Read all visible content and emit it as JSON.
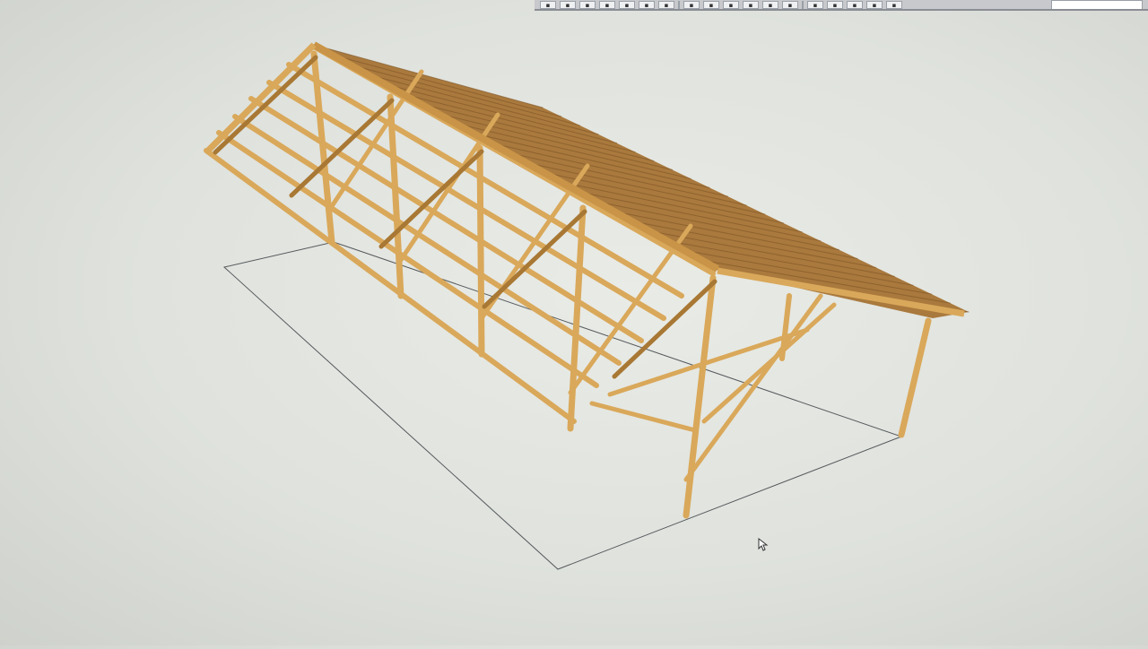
{
  "window": {
    "title": ""
  },
  "toolbar": {
    "buttons": [
      {
        "icon": "select-icon"
      },
      {
        "icon": "new-file-icon"
      },
      {
        "icon": "open-icon"
      },
      {
        "icon": "save-icon"
      },
      {
        "icon": "print-icon"
      },
      {
        "icon": "material-icon"
      },
      {
        "icon": "zoom-icon"
      },
      {
        "icon": "copy-icon"
      },
      {
        "icon": "paste-icon"
      },
      {
        "icon": "edit-icon"
      },
      {
        "icon": "paint-icon"
      },
      {
        "icon": "camera-icon"
      },
      {
        "icon": "globe-icon"
      },
      {
        "icon": "settings-icon"
      },
      {
        "icon": "tag-icon"
      },
      {
        "icon": "gem-icon"
      },
      {
        "icon": "pencil-icon"
      },
      {
        "icon": "layers-icon"
      }
    ],
    "search_placeholder": ""
  },
  "model": {
    "description_visible": false,
    "wood_color": "#d9a85a",
    "wood_shadow": "#a87834",
    "roof_color": "#a9793d",
    "ground_outline": "#55595c",
    "background": "#e2e5e0"
  }
}
